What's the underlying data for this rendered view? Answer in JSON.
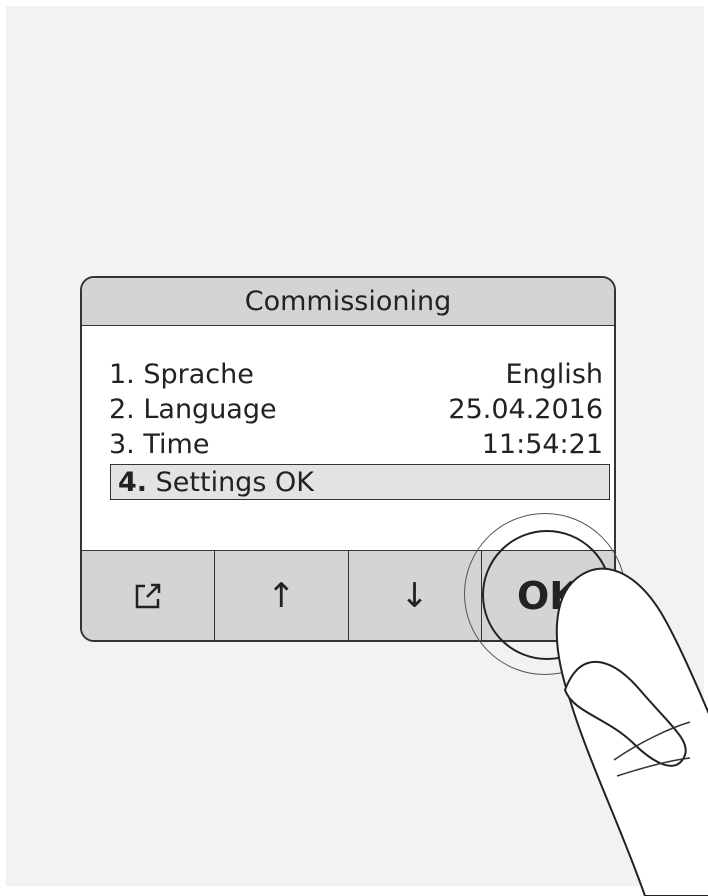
{
  "screen": {
    "title": "Commissioning",
    "menu": [
      {
        "num": "1.",
        "label": "Sprache",
        "value": "English"
      },
      {
        "num": "2.",
        "label": "Language",
        "value": "25.04.2016"
      },
      {
        "num": "3.",
        "label": "Time",
        "value": "11:54:21"
      },
      {
        "num": "4.",
        "label": "Settings OK",
        "value": ""
      }
    ],
    "selected_index": 3
  },
  "buttons": [
    {
      "name": "back",
      "icon": "export-arrow-icon"
    },
    {
      "name": "up",
      "label": "↑",
      "icon": "arrow-up-icon"
    },
    {
      "name": "down",
      "label": "↓",
      "icon": "arrow-down-icon"
    },
    {
      "name": "ok",
      "label": "OK"
    }
  ]
}
